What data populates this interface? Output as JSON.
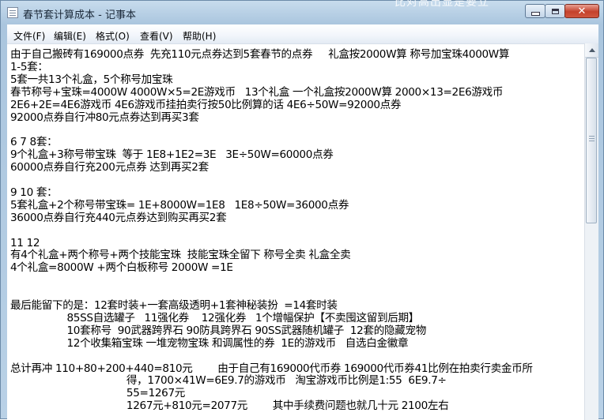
{
  "window": {
    "title": "春节套计算成本 - 记事本",
    "background_text": "比对高出显是要立",
    "close_symbol": "✕"
  },
  "menu": {
    "items": [
      "文件(F)",
      "编辑(E)",
      "格式(O)",
      "查看(V)",
      "帮助(H)"
    ]
  },
  "editor": {
    "lines": [
      "由于自己搬砖有169000点券  先充110元点券达到5套春节的点券     礼盒按2000W算 称号加宝珠4000W算",
      "1-5套：",
      "5套一共13个礼盒，5个称号加宝珠",
      "春节称号+宝珠=4000W 4000W×5=2E游戏币   13个礼盒 一个礼盒按2000W算 2000×13=2E6游戏币",
      "2E6+2E=4E6游戏币 4E6游戏币挂拍卖行按50比例算的话 4E6÷50W=92000点券",
      "92000点券自行冲80元点券达到再买3套",
      "",
      "6 7 8套：",
      "9个礼盒+3称号带宝珠  等于 1E8+1E2=3E   3E÷50W=60000点券",
      "60000点券自行充200元点券 达到再买2套",
      "",
      "9 10 套：",
      "5套礼盒+2个称号带宝珠= 1E+8000W=1E8   1E8÷50W=36000点券",
      "36000点券自行充440元点券达到购买再买2套",
      "",
      "11 12",
      "有4个礼盒+两个称号+两个技能宝珠  技能宝珠全留下 称号全卖 礼盒全卖",
      "4个礼盒=8000W +两个白板称号 2000W =1E",
      "",
      "",
      "最后能留下的是：12套时装+一套高级透明+1套神秘装扮  =14套时装",
      "                  85SS自选罐子   11强化券    12强化券   1个增幅保护【不卖囤这留到后期】",
      "                  10套称号  90武器跨界石 90防具跨界石 90SS武器随机罐子  12套的隐藏宠物",
      "                  12个收集箱宝珠 一堆宠物宝珠 和调属性的券  1E的游戏币   自选白金徽章",
      "",
      "总计再冲 110+80+200+440=810元        由于自己有169000代币券 169000代币券41比例在拍卖行卖金币所",
      "                                     得，1700×41W=6E9.7的游戏币   淘宝游戏币比例是1:55  6E9.7÷",
      "                                     55=1267元",
      "                                     1267元+810元=2077元        其中手续费问题也就几十元 2100左右"
    ]
  }
}
